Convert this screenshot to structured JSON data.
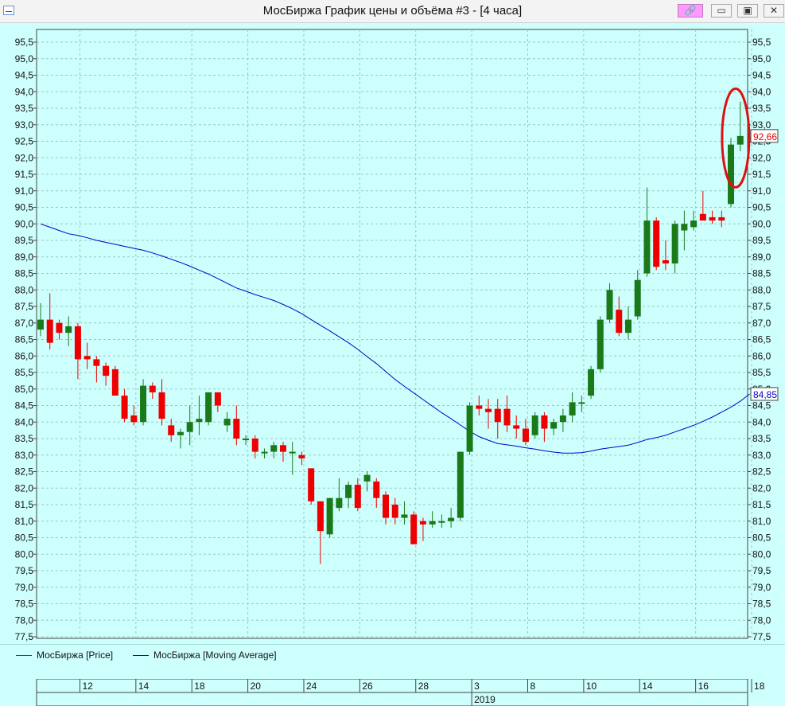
{
  "window": {
    "title": "МосБиржа График цены и объёма #3 - [4 часа]",
    "buttons": {
      "link": "🔗",
      "minimize": "▭",
      "maximize": "▣",
      "close": "✕"
    }
  },
  "legend": [
    {
      "label": "МосБиржа [Price]",
      "color": "#cc0000"
    },
    {
      "label": "МосБиржа [Moving Average]",
      "color": "#0000cc"
    }
  ],
  "colors": {
    "up": "#1a7a1a",
    "down": "#ee0000",
    "ma": "#0000cc",
    "grid": "#9cc7c5",
    "background": "#cdfffd",
    "annotation": "#dd1111"
  },
  "chart_data": {
    "type": "candlestick",
    "ylim": [
      77.5,
      95.5
    ],
    "yticks": [
      "95,5",
      "95,0",
      "94,5",
      "94,0",
      "93,5",
      "93,0",
      "92,5",
      "92,0",
      "91,5",
      "91,0",
      "90,5",
      "90,0",
      "89,5",
      "89,0",
      "88,5",
      "88,0",
      "87,5",
      "87,0",
      "86,5",
      "86,0",
      "85,5",
      "85,0",
      "84,5",
      "84,0",
      "83,5",
      "83,0",
      "82,5",
      "82,0",
      "81,5",
      "81,0",
      "80,5",
      "80,0",
      "79,5",
      "79,0",
      "78,5",
      "78,0",
      "77,5"
    ],
    "last_price_label": "92,66",
    "ma_last_label": "84,85",
    "x_ticks": [
      {
        "label": "12",
        "index": 2
      },
      {
        "label": "14",
        "index": 8
      },
      {
        "label": "18",
        "index": 14
      },
      {
        "label": "20",
        "index": 20
      },
      {
        "label": "24",
        "index": 26
      },
      {
        "label": "26",
        "index": 32
      },
      {
        "label": "28",
        "index": 38
      },
      {
        "label": "3",
        "index": 44
      },
      {
        "label": "8",
        "index": 50
      },
      {
        "label": "10",
        "index": 56
      },
      {
        "label": "14",
        "index": 62
      },
      {
        "label": "16",
        "index": 68
      },
      {
        "label": "18",
        "index": 74
      }
    ],
    "year_label": "2019",
    "year_index": 44,
    "candles": [
      {
        "o": 86.8,
        "h": 87.6,
        "l": 86.6,
        "c": 87.1
      },
      {
        "o": 87.1,
        "h": 87.9,
        "l": 86.2,
        "c": 86.4
      },
      {
        "o": 87.0,
        "h": 87.1,
        "l": 86.5,
        "c": 86.7
      },
      {
        "o": 86.7,
        "h": 87.2,
        "l": 86.3,
        "c": 86.9
      },
      {
        "o": 86.9,
        "h": 87.0,
        "l": 85.3,
        "c": 85.9
      },
      {
        "o": 86.0,
        "h": 86.4,
        "l": 85.6,
        "c": 85.9
      },
      {
        "o": 85.9,
        "h": 86.0,
        "l": 85.2,
        "c": 85.7
      },
      {
        "o": 85.7,
        "h": 85.8,
        "l": 85.1,
        "c": 85.4
      },
      {
        "o": 85.6,
        "h": 85.7,
        "l": 84.9,
        "c": 84.8
      },
      {
        "o": 84.8,
        "h": 85.0,
        "l": 84.0,
        "c": 84.1
      },
      {
        "o": 84.2,
        "h": 84.5,
        "l": 83.9,
        "c": 84.0
      },
      {
        "o": 84.0,
        "h": 85.3,
        "l": 83.9,
        "c": 85.1
      },
      {
        "o": 85.1,
        "h": 85.2,
        "l": 84.7,
        "c": 84.9
      },
      {
        "o": 84.9,
        "h": 85.3,
        "l": 83.9,
        "c": 84.1
      },
      {
        "o": 83.9,
        "h": 84.1,
        "l": 83.4,
        "c": 83.6
      },
      {
        "o": 83.6,
        "h": 83.8,
        "l": 83.2,
        "c": 83.7
      },
      {
        "o": 83.7,
        "h": 84.5,
        "l": 83.3,
        "c": 84.0
      },
      {
        "o": 84.0,
        "h": 84.8,
        "l": 83.6,
        "c": 84.1
      },
      {
        "o": 84.0,
        "h": 84.9,
        "l": 83.9,
        "c": 84.9
      },
      {
        "o": 84.9,
        "h": 84.9,
        "l": 84.3,
        "c": 84.5
      },
      {
        "o": 83.9,
        "h": 84.3,
        "l": 83.7,
        "c": 84.1
      },
      {
        "o": 84.1,
        "h": 84.5,
        "l": 83.3,
        "c": 83.5
      },
      {
        "o": 83.5,
        "h": 83.6,
        "l": 83.3,
        "c": 83.5
      },
      {
        "o": 83.5,
        "h": 83.6,
        "l": 82.9,
        "c": 83.1
      },
      {
        "o": 83.1,
        "h": 83.2,
        "l": 82.9,
        "c": 83.1
      },
      {
        "o": 83.1,
        "h": 83.4,
        "l": 82.9,
        "c": 83.3
      },
      {
        "o": 83.3,
        "h": 83.4,
        "l": 82.8,
        "c": 83.1
      },
      {
        "o": 83.1,
        "h": 83.4,
        "l": 82.4,
        "c": 83.1
      },
      {
        "o": 83.0,
        "h": 83.1,
        "l": 82.7,
        "c": 82.9
      },
      {
        "o": 82.6,
        "h": 82.6,
        "l": 81.5,
        "c": 81.6
      },
      {
        "o": 81.6,
        "h": 81.6,
        "l": 79.7,
        "c": 80.7
      },
      {
        "o": 80.6,
        "h": 81.7,
        "l": 80.5,
        "c": 81.7
      },
      {
        "o": 81.4,
        "h": 82.3,
        "l": 81.3,
        "c": 81.7
      },
      {
        "o": 81.7,
        "h": 82.2,
        "l": 81.4,
        "c": 82.1
      },
      {
        "o": 82.1,
        "h": 82.3,
        "l": 81.3,
        "c": 81.4
      },
      {
        "o": 82.2,
        "h": 82.5,
        "l": 81.9,
        "c": 82.4
      },
      {
        "o": 82.2,
        "h": 82.3,
        "l": 81.4,
        "c": 81.7
      },
      {
        "o": 81.8,
        "h": 81.9,
        "l": 80.9,
        "c": 81.1
      },
      {
        "o": 81.5,
        "h": 81.7,
        "l": 80.9,
        "c": 81.1
      },
      {
        "o": 81.1,
        "h": 81.6,
        "l": 80.9,
        "c": 81.2
      },
      {
        "o": 81.2,
        "h": 81.3,
        "l": 80.3,
        "c": 80.3
      },
      {
        "o": 81.0,
        "h": 81.1,
        "l": 80.4,
        "c": 80.9
      },
      {
        "o": 80.9,
        "h": 81.3,
        "l": 80.8,
        "c": 81.0
      },
      {
        "o": 81.0,
        "h": 81.2,
        "l": 80.8,
        "c": 81.0
      },
      {
        "o": 81.0,
        "h": 81.4,
        "l": 80.8,
        "c": 81.1
      },
      {
        "o": 81.1,
        "h": 83.1,
        "l": 81.0,
        "c": 83.1
      },
      {
        "o": 83.1,
        "h": 84.6,
        "l": 83.0,
        "c": 84.5
      },
      {
        "o": 84.5,
        "h": 84.8,
        "l": 84.2,
        "c": 84.4
      },
      {
        "o": 84.4,
        "h": 84.7,
        "l": 83.8,
        "c": 84.3
      },
      {
        "o": 84.4,
        "h": 84.7,
        "l": 83.5,
        "c": 84.0
      },
      {
        "o": 84.4,
        "h": 84.8,
        "l": 83.7,
        "c": 83.9
      },
      {
        "o": 83.9,
        "h": 84.2,
        "l": 83.5,
        "c": 83.8
      },
      {
        "o": 83.8,
        "h": 84.1,
        "l": 83.3,
        "c": 83.4
      },
      {
        "o": 83.6,
        "h": 84.3,
        "l": 83.5,
        "c": 84.2
      },
      {
        "o": 84.2,
        "h": 84.3,
        "l": 83.4,
        "c": 83.8
      },
      {
        "o": 83.8,
        "h": 84.1,
        "l": 83.6,
        "c": 84.0
      },
      {
        "o": 84.0,
        "h": 84.4,
        "l": 83.7,
        "c": 84.2
      },
      {
        "o": 84.2,
        "h": 84.9,
        "l": 84.0,
        "c": 84.6
      },
      {
        "o": 84.6,
        "h": 84.8,
        "l": 84.3,
        "c": 84.6
      },
      {
        "o": 84.8,
        "h": 85.7,
        "l": 84.7,
        "c": 85.6
      },
      {
        "o": 85.6,
        "h": 87.2,
        "l": 85.5,
        "c": 87.1
      },
      {
        "o": 87.1,
        "h": 88.2,
        "l": 87.0,
        "c": 88.0
      },
      {
        "o": 87.4,
        "h": 87.8,
        "l": 86.6,
        "c": 86.7
      },
      {
        "o": 86.7,
        "h": 87.5,
        "l": 86.5,
        "c": 87.1
      },
      {
        "o": 87.2,
        "h": 88.6,
        "l": 87.1,
        "c": 88.3
      },
      {
        "o": 88.5,
        "h": 91.1,
        "l": 88.4,
        "c": 90.1
      },
      {
        "o": 90.1,
        "h": 90.2,
        "l": 88.6,
        "c": 88.7
      },
      {
        "o": 88.9,
        "h": 89.5,
        "l": 88.6,
        "c": 88.8
      },
      {
        "o": 88.8,
        "h": 90.1,
        "l": 88.5,
        "c": 90.0
      },
      {
        "o": 89.8,
        "h": 90.4,
        "l": 89.2,
        "c": 90.0
      },
      {
        "o": 89.9,
        "h": 90.4,
        "l": 89.8,
        "c": 90.1
      },
      {
        "o": 90.3,
        "h": 91.0,
        "l": 90.2,
        "c": 90.1
      },
      {
        "o": 90.2,
        "h": 90.4,
        "l": 90.0,
        "c": 90.1
      },
      {
        "o": 90.2,
        "h": 90.4,
        "l": 89.9,
        "c": 90.1
      },
      {
        "o": 90.6,
        "h": 92.6,
        "l": 90.5,
        "c": 92.4
      },
      {
        "o": 92.4,
        "h": 93.7,
        "l": 92.2,
        "c": 92.66
      }
    ],
    "moving_average": [
      90.0,
      89.9,
      89.8,
      89.7,
      89.65,
      89.58,
      89.5,
      89.44,
      89.38,
      89.32,
      89.26,
      89.2,
      89.12,
      89.03,
      88.93,
      88.83,
      88.72,
      88.6,
      88.48,
      88.34,
      88.2,
      88.06,
      87.96,
      87.86,
      87.77,
      87.68,
      87.56,
      87.43,
      87.28,
      87.1,
      86.93,
      86.76,
      86.58,
      86.4,
      86.2,
      85.98,
      85.77,
      85.53,
      85.29,
      85.08,
      84.88,
      84.68,
      84.48,
      84.28,
      84.1,
      83.91,
      83.72,
      83.56,
      83.45,
      83.35,
      83.31,
      83.27,
      83.22,
      83.18,
      83.13,
      83.09,
      83.06,
      83.06,
      83.07,
      83.12,
      83.18,
      83.22,
      83.26,
      83.3,
      83.38,
      83.47,
      83.53,
      83.6,
      83.7,
      83.8,
      83.9,
      84.02,
      84.15,
      84.3,
      84.45,
      84.63,
      84.85
    ]
  }
}
